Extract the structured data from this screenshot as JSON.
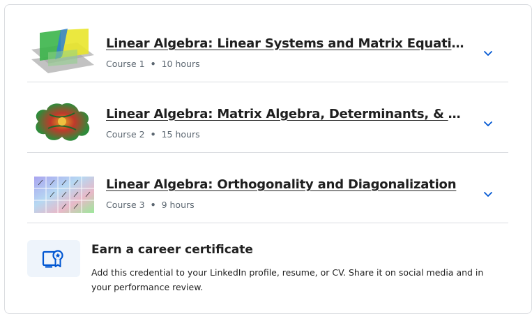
{
  "courses": [
    {
      "title": "Linear Algebra: Linear Systems and Matrix Equations",
      "course_label": "Course 1",
      "duration": "10 hours",
      "thumbnail_icon": "3d-planes-thumbnail"
    },
    {
      "title": "Linear Algebra: Matrix Algebra, Determinants, & Eigenvec...",
      "course_label": "Course 2",
      "duration": "15 hours",
      "thumbnail_icon": "colorful-surface-thumbnail"
    },
    {
      "title": "Linear Algebra: Orthogonality and Diagonalization",
      "course_label": "Course 3",
      "duration": "9 hours",
      "thumbnail_icon": "color-grid-thumbnail"
    }
  ],
  "meta_separator": "•",
  "expand_icon": "chevron-down-icon",
  "certificate": {
    "title": "Earn a career certificate",
    "description": "Add this credential to your LinkedIn profile, resume, or CV. Share it on social media and in your performance review.",
    "icon": "certificate-icon"
  },
  "colors": {
    "accent": "#0056d2",
    "text": "#1f1f1f",
    "muted": "#5b6670",
    "divider": "#dadce0",
    "cert_bg": "#eef4fb"
  }
}
